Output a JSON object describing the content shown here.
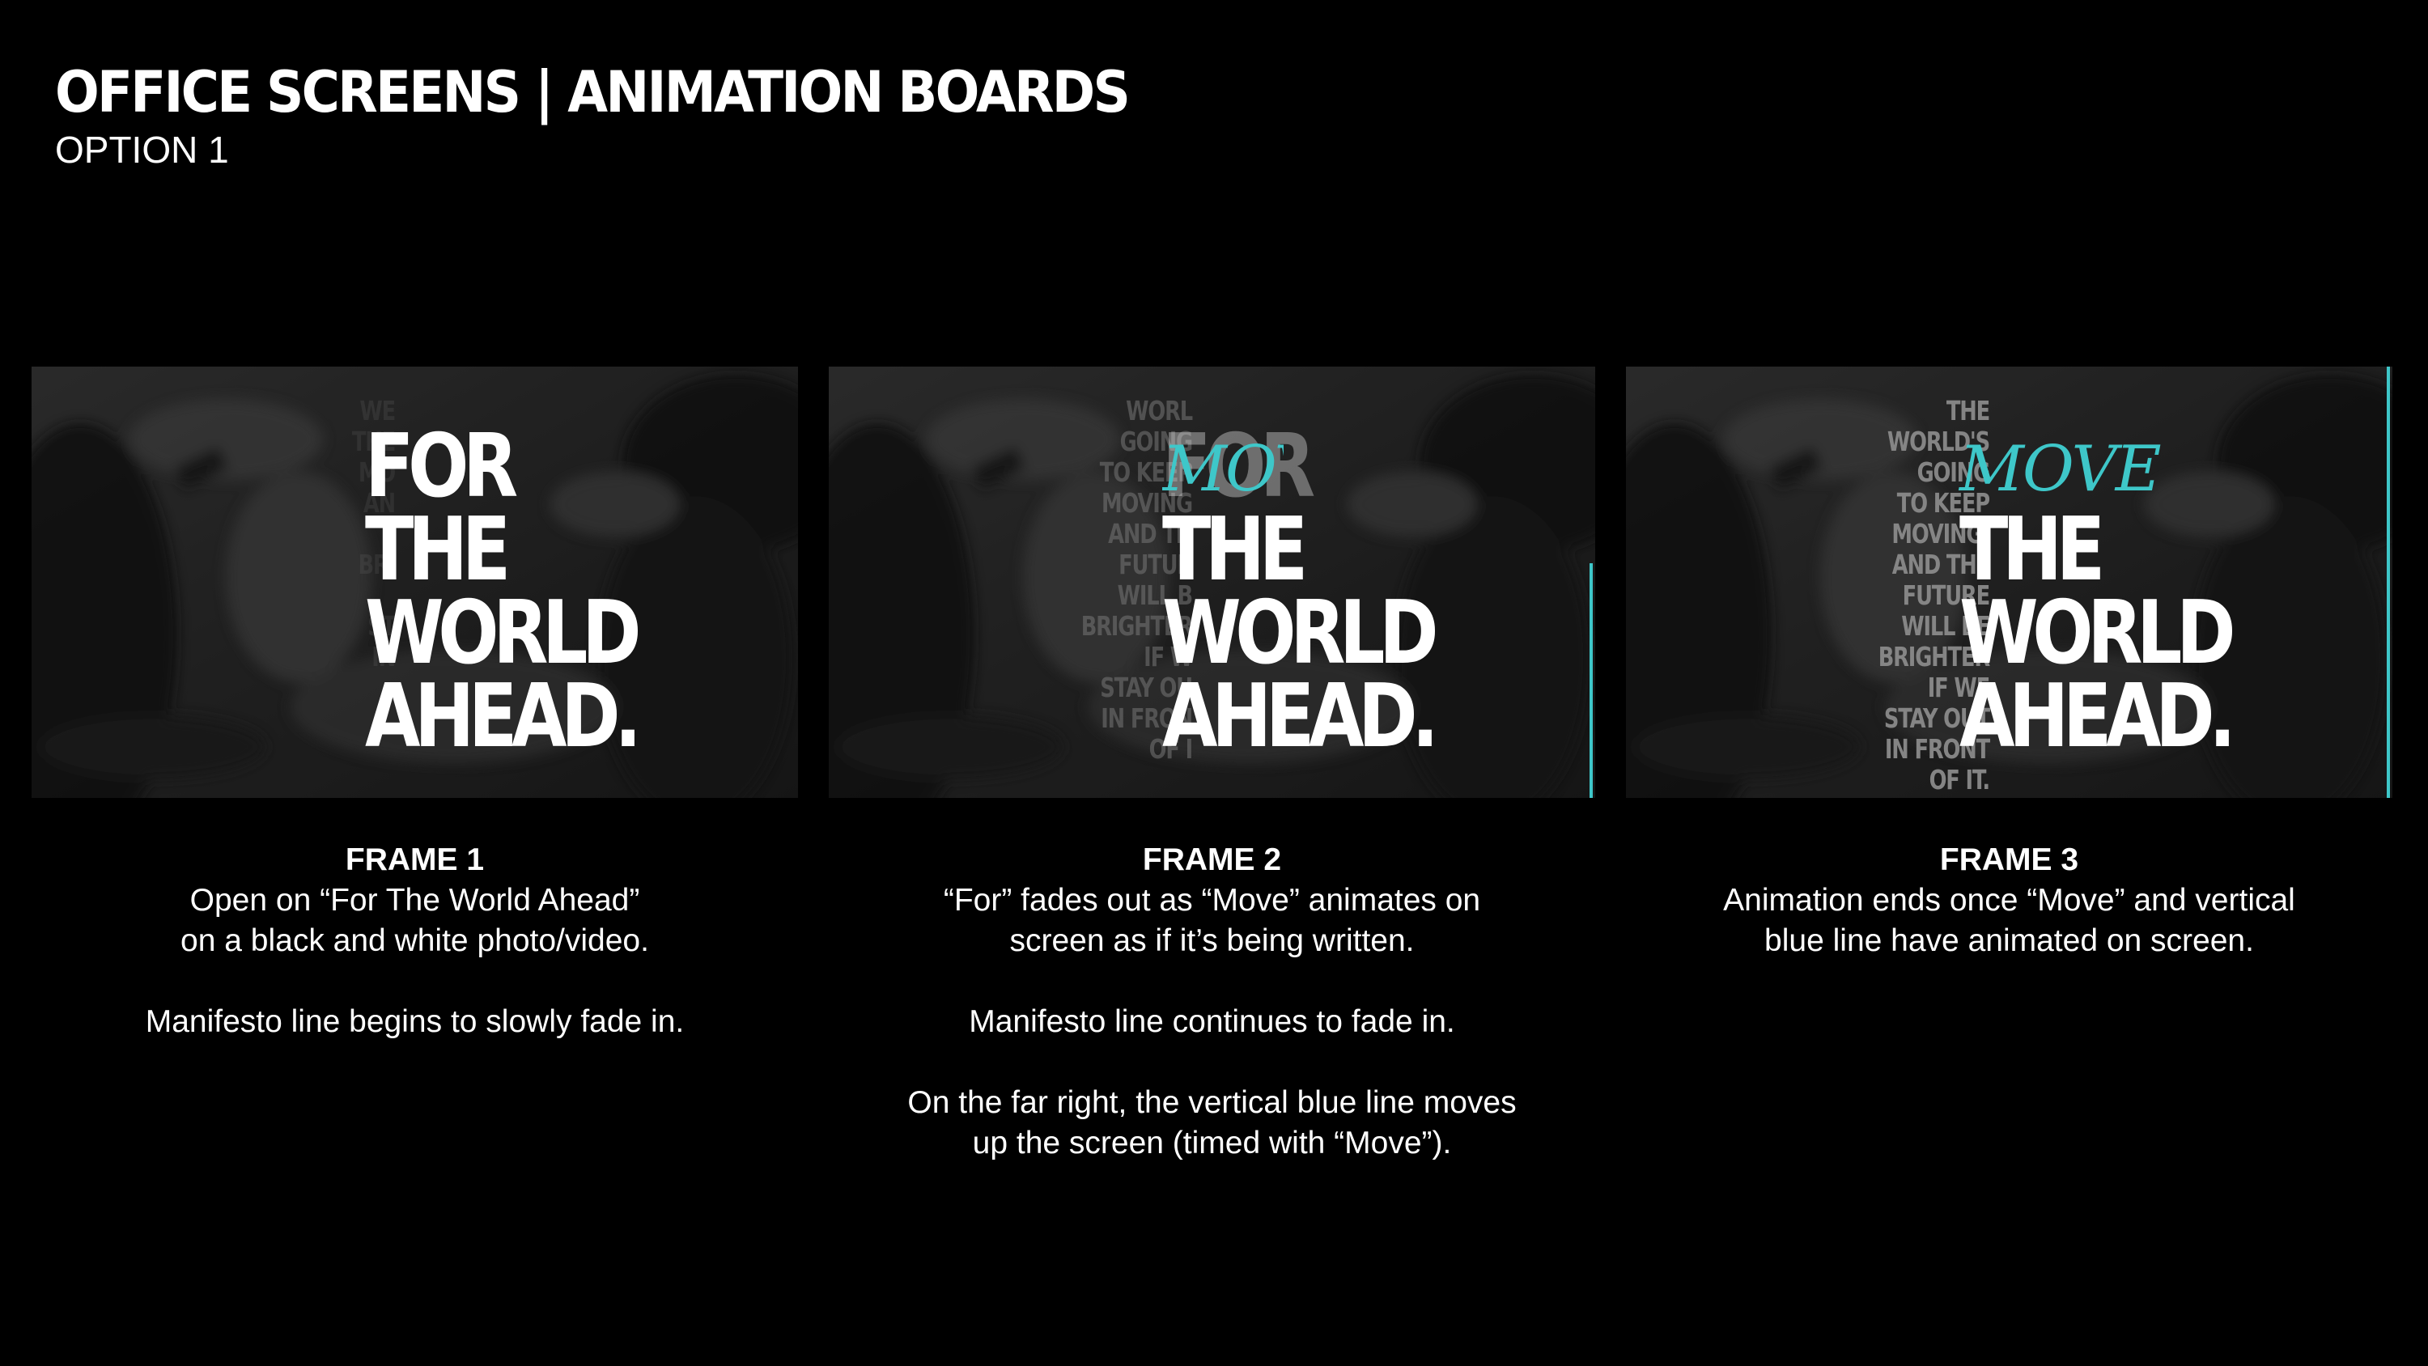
{
  "header": {
    "title": "OFFICE SCREENS | ANIMATION BOARDS",
    "subtitle": "OPTION 1"
  },
  "colors": {
    "background": "#000000",
    "accent": "#3ec7c9",
    "text": "#ffffff"
  },
  "frames": [
    {
      "headline": "FOR\nTHE\nWORLD\nAHEAD.",
      "manifesto": "WE\nTHE\nMO\nAN\nF\nBRI\n \nST\nIN",
      "caption_title": "FRAME 1",
      "caption_paragraphs": [
        "Open on “For The World Ahead”\non a black and white photo/video.",
        "Manifesto line begins to slowly fade in."
      ]
    },
    {
      "headline_for": "FOR",
      "headline_rest": "THE\nWORLD\nAHEAD.",
      "move": "MOV",
      "manifesto": "WORL\nGOING\nTO KEEP\nMOVING\nAND TH\nFUTUR\nWILL B\nBRIGHTER\nIF W\nSTAY OU\nIN FRON\nOF I",
      "caption_title": "FRAME 2",
      "caption_paragraphs": [
        "“For” fades out as “Move” animates on\nscreen as if it’s being written.",
        "Manifesto line continues to fade in.",
        "On the far right, the vertical blue line moves\nup the screen (timed with “Move”)."
      ]
    },
    {
      "headline": "THE\nWORLD\nAHEAD.",
      "move": "MOVE",
      "manifesto": "THE\nWORLD'S\nGOING\nTO KEEP\nMOVING,\nAND THE\nFUTURE\nWILL BE\nBRIGHTER\nIF WE\nSTAY OUT\nIN FRONT\nOF IT.",
      "caption_title": "FRAME 3",
      "caption_paragraphs": [
        "Animation ends once “Move” and vertical\nblue line have animated on screen."
      ]
    }
  ]
}
